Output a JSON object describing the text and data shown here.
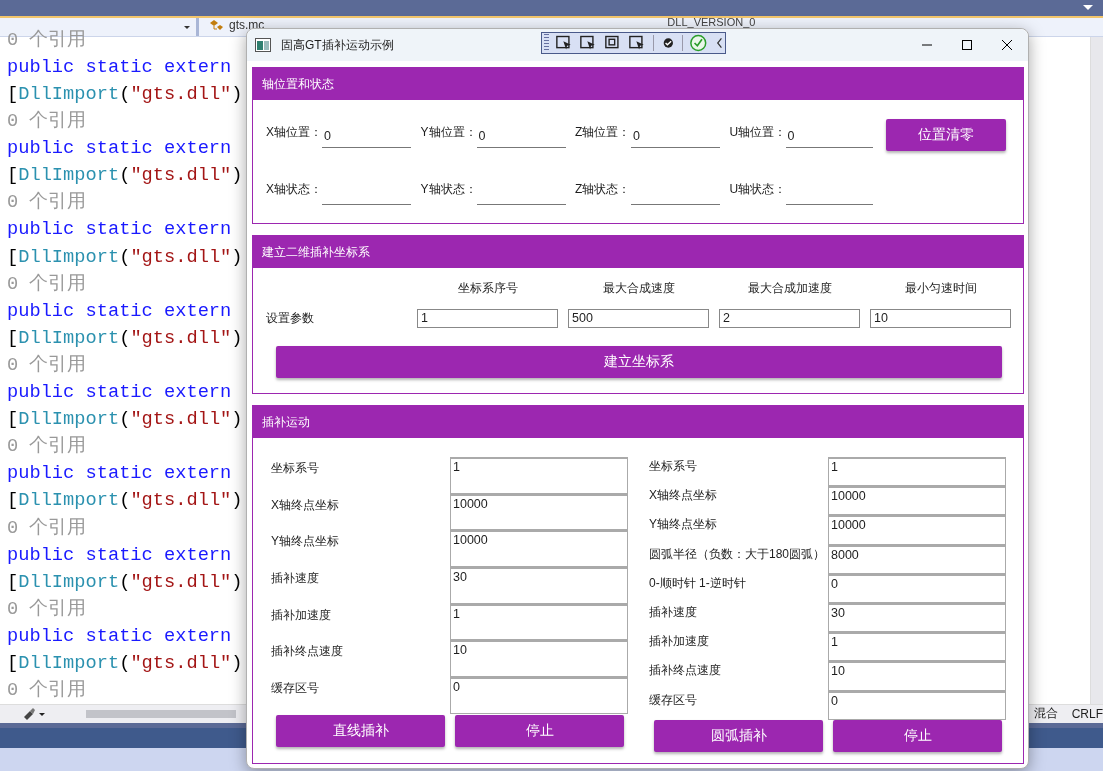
{
  "ide": {
    "file_tab": "gts.mc",
    "member_field": "DLL_VERSION_0",
    "code_lines": [
      {
        "kind": "refs",
        "text": "0 个引用"
      },
      {
        "kind": "keyword",
        "text": "public static extern"
      },
      {
        "kind": "attribute",
        "parts": [
          "[",
          "DllImport",
          "(",
          "\"gts.dll\"",
          ")"
        ]
      },
      {
        "kind": "refs",
        "text": "0 个引用"
      },
      {
        "kind": "keyword",
        "text": "public static extern"
      },
      {
        "kind": "attribute",
        "parts": [
          "[",
          "DllImport",
          "(",
          "\"gts.dll\"",
          ")"
        ]
      },
      {
        "kind": "refs",
        "text": "0 个引用"
      },
      {
        "kind": "keyword",
        "text": "public static extern"
      },
      {
        "kind": "attribute",
        "parts": [
          "[",
          "DllImport",
          "(",
          "\"gts.dll\"",
          ")"
        ]
      },
      {
        "kind": "refs",
        "text": "0 个引用"
      },
      {
        "kind": "keyword",
        "text": "public static extern"
      },
      {
        "kind": "attribute",
        "parts": [
          "[",
          "DllImport",
          "(",
          "\"gts.dll\"",
          ")"
        ]
      },
      {
        "kind": "refs",
        "text": "0 个引用"
      },
      {
        "kind": "keyword",
        "text": "public static extern"
      },
      {
        "kind": "attribute",
        "parts": [
          "[",
          "DllImport",
          "(",
          "\"gts.dll\"",
          ")"
        ]
      },
      {
        "kind": "refs",
        "text": "0 个引用"
      },
      {
        "kind": "keyword",
        "text": "public static extern"
      },
      {
        "kind": "attribute",
        "parts": [
          "[",
          "DllImport",
          "(",
          "\"gts.dll\"",
          ")"
        ]
      },
      {
        "kind": "refs",
        "text": "0 个引用"
      },
      {
        "kind": "keyword",
        "text": "public static extern"
      },
      {
        "kind": "attribute",
        "parts": [
          "[",
          "DllImport",
          "(",
          "\"gts.dll\"",
          ")"
        ]
      },
      {
        "kind": "refs",
        "text": "0 个引用"
      },
      {
        "kind": "keyword",
        "text": "public static extern"
      },
      {
        "kind": "attribute",
        "parts": [
          "[",
          "DllImport",
          "(",
          "\"gts.dll\"",
          ")"
        ]
      },
      {
        "kind": "refs",
        "text": "0 个引用"
      }
    ],
    "status": [
      "混合",
      "CRLF"
    ]
  },
  "dialog": {
    "title": "固高GT插补运动示例",
    "axis_section": {
      "title": "轴位置和状态",
      "positions": [
        {
          "label": "X轴位置：",
          "value": "0"
        },
        {
          "label": "Y轴位置：",
          "value": "0"
        },
        {
          "label": "Z轴位置：",
          "value": "0"
        },
        {
          "label": "U轴位置：",
          "value": "0"
        }
      ],
      "states": [
        {
          "label": "X轴状态："
        },
        {
          "label": "Y轴状态："
        },
        {
          "label": "Z轴状态："
        },
        {
          "label": "U轴状态："
        }
      ],
      "button": "位置清零"
    },
    "coord_section": {
      "title": "建立二维插补坐标系",
      "row_label": "设置参数",
      "params": [
        {
          "header": "坐标系序号",
          "value": "1"
        },
        {
          "header": "最大合成速度",
          "value": "500"
        },
        {
          "header": "最大合成加速度",
          "value": "2"
        },
        {
          "header": "最小匀速时间",
          "value": "10"
        }
      ],
      "button": "建立坐标系"
    },
    "motion_section": {
      "title": "插补运动",
      "line": {
        "fields": [
          {
            "label": "坐标系号",
            "value": "1"
          },
          {
            "label": "X轴终点坐标",
            "value": "10000"
          },
          {
            "label": "Y轴终点坐标",
            "value": "10000"
          },
          {
            "label": "插补速度",
            "value": "30"
          },
          {
            "label": "插补加速度",
            "value": "1"
          },
          {
            "label": "插补终点速度",
            "value": "10"
          },
          {
            "label": "缓存区号",
            "value": "0"
          }
        ],
        "buttons": [
          "直线插补",
          "停止"
        ]
      },
      "arc": {
        "fields": [
          {
            "label": "坐标系号",
            "value": "1"
          },
          {
            "label": "X轴终点坐标",
            "value": "10000"
          },
          {
            "label": "Y轴终点坐标",
            "value": "10000"
          },
          {
            "label": "圆弧半径（负数：大于180圆弧）",
            "value": "8000"
          },
          {
            "label": "0-顺时针 1-逆时针",
            "value": "0"
          },
          {
            "label": "插补速度",
            "value": "30"
          },
          {
            "label": "插补加速度",
            "value": "1"
          },
          {
            "label": "插补终点速度",
            "value": "10"
          },
          {
            "label": "缓存区号",
            "value": "0"
          }
        ],
        "buttons": [
          "圆弧插补",
          "停止"
        ]
      }
    }
  }
}
